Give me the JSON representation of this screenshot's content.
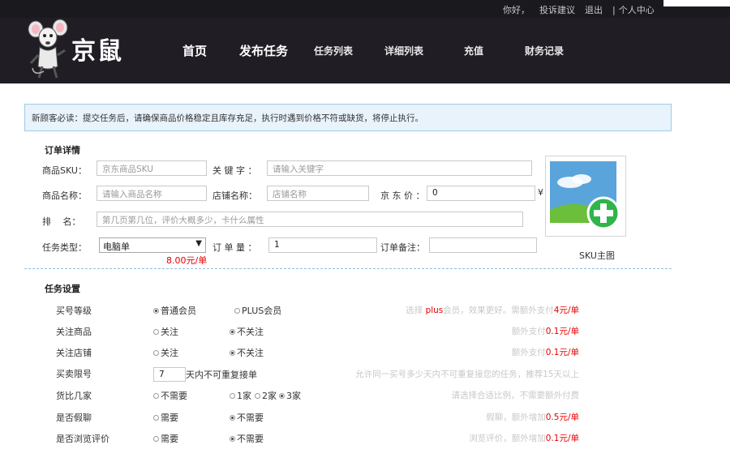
{
  "topbar": {
    "greeting": "你好，",
    "feedback": "投诉建议",
    "logout": "退出",
    "separator": "|",
    "user_center": "个人中心"
  },
  "logo": {
    "brand": "京鼠"
  },
  "nav": {
    "home": "首页",
    "publish": "发布任务",
    "task_list": "任务列表",
    "detail_list": "详细列表",
    "recharge": "充值",
    "finance": "财务记录"
  },
  "notice": "新顾客必读：提交任务后，请确保商品价格稳定且库存充足，执行时遇到价格不符或缺货，将停止执行。",
  "order": {
    "title": "订单详情",
    "sku_label": "商品SKU：",
    "sku_placeholder": "京东商品SKU",
    "keyword_label": "关 键 字 ：",
    "keyword_placeholder": "请输入关键字",
    "name_label": "商品名称：",
    "name_placeholder": "请输入商品名称",
    "shop_label": "店铺名称：",
    "shop_placeholder": "店铺名称",
    "price_label": "京 东 价 ：",
    "price_value": "0",
    "price_unit": "¥",
    "rank_label": "排　 名：",
    "rank_placeholder": "第几页第几位，评价大概多少，卡什么属性",
    "type_label": "任务类型：",
    "type_value": "电脑单",
    "type_price": "8.00元/单",
    "qty_label": "订 单 量 ：",
    "qty_value": "1",
    "remark_label": "订单备注：",
    "remark_value": "",
    "sku_image_label": "SKU主图"
  },
  "settings": {
    "title": "任务设置",
    "rows": [
      {
        "label": "买号等级",
        "opt1": "普通会员",
        "opt2": "PLUS会员",
        "hint_pre": "选择 ",
        "hint_red": "plus",
        "hint_mid": "会员，效果更好。需额外支付",
        "hint_red2": "4元/单"
      },
      {
        "label": "关注商品",
        "opt1": "关注",
        "opt2": "不关注",
        "hint_mid": "额外支付",
        "hint_red2": "0.1元/单"
      },
      {
        "label": "关注店铺",
        "opt1": "关注",
        "opt2": "不关注",
        "hint_mid": "额外支付",
        "hint_red2": "0.1元/单"
      },
      {
        "label": "买卖限号",
        "input_value": "7",
        "suffix": "天内不可重复接单",
        "hint_mid": "允许同一买号多少天内不可重复接您的任务，推荐15天以上"
      },
      {
        "label": "货比几家",
        "opt1": "不需要",
        "opt2": "1家",
        "opt3": "2家",
        "opt4": "3家",
        "hint_mid": "请选择合适比例，不需要额外付费"
      },
      {
        "label": "是否假聊",
        "opt1": "需要",
        "opt2": "不需要",
        "hint_mid": "假聊，额外增加",
        "hint_red2": "0.5元/单"
      },
      {
        "label": "是否浏览评价",
        "opt1": "需要",
        "opt2": "不需要",
        "hint_mid": "浏览评价，额外增加",
        "hint_red2": "0.1元/单"
      }
    ]
  },
  "colors": {
    "header_bg": "#201d25",
    "notice_bg": "#e8f3fc",
    "accent_red": "#e60000",
    "plus_green": "#2fb54a"
  }
}
